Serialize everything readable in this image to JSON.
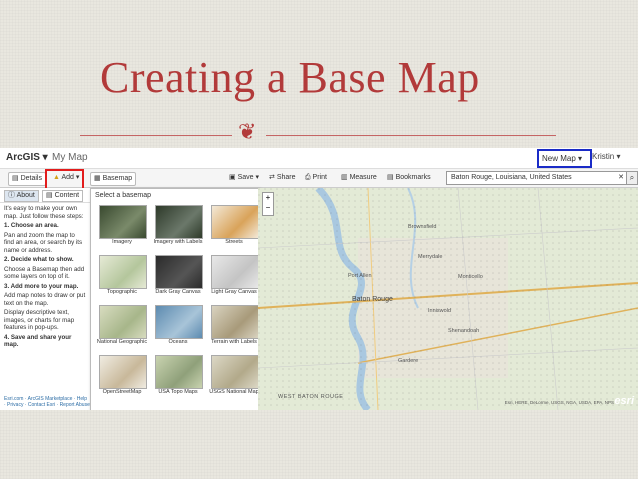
{
  "slide": {
    "title": "Creating a Base Map",
    "flourish": "❦"
  },
  "app": {
    "brand": "ArcGIS ▾",
    "map_title": "My Map",
    "new_map": "New Map ▾",
    "user": "Kristin ▾"
  },
  "toolbar": {
    "details": "Details",
    "add": "Add ▾",
    "basemap": "Basemap",
    "save": "Save ▾",
    "share": "Share",
    "print": "Print",
    "measure": "Measure",
    "bookmarks": "Bookmarks",
    "search_value": "Baton Rouge, Louisiana, United States",
    "search_clear": "✕"
  },
  "sidebar": {
    "tab_about": "About",
    "tab_content": "Content",
    "lines": [
      "It's easy to make your own map. Just follow these steps:",
      "1. Choose an area.",
      "Pan and zoom the map to find an area, or search by its name or address.",
      "2. Decide what to show.",
      "Choose a Basemap then add some layers on top of it.",
      "3. Add more to your map.",
      "Add map notes to draw or put text on the map.",
      "Display descriptive text, images, or charts for map features in pop-ups.",
      "4. Save and share your map."
    ],
    "footer": "Esri.com · ArcGIS Marketplace · Help · Privacy · Contact Esri · Report Abuse"
  },
  "basemap_panel": {
    "title": "Select a basemap",
    "options": [
      {
        "label": "Imagery",
        "c1": "#3a4a30",
        "c2": "#7a8a6a"
      },
      {
        "label": "Imagery with Labels",
        "c1": "#2e3a2a",
        "c2": "#6b786a"
      },
      {
        "label": "Streets",
        "c1": "#f3e9d8",
        "c2": "#d9a35a"
      },
      {
        "label": "Topographic",
        "c1": "#e6ead6",
        "c2": "#b4c69c"
      },
      {
        "label": "Dark Gray Canvas",
        "c1": "#2b2b2b",
        "c2": "#555555"
      },
      {
        "label": "Light Gray Canvas",
        "c1": "#e8e8e8",
        "c2": "#c4c4c4"
      },
      {
        "label": "National Geographic",
        "c1": "#d8dcc0",
        "c2": "#a7b68a"
      },
      {
        "label": "Oceans",
        "c1": "#5d8bb0",
        "c2": "#a8c4d8"
      },
      {
        "label": "Terrain with Labels",
        "c1": "#d9d3c0",
        "c2": "#a89a7a"
      },
      {
        "label": "OpenStreetMap",
        "c1": "#f0ece2",
        "c2": "#c8b89a"
      },
      {
        "label": "USA Topo Maps",
        "c1": "#c9d3b0",
        "c2": "#8fa07a"
      },
      {
        "label": "USGS National Map",
        "c1": "#dcd8c6",
        "c2": "#b2a98a"
      }
    ]
  },
  "map": {
    "labels": [
      "Baton Rouge",
      "Brownsfield",
      "Merrydale",
      "Monticello",
      "Shenandoah",
      "Gardere",
      "Port Allen",
      "Inniswold",
      "WEST BATON ROUGE"
    ],
    "attribution": "Esri, HERE, DeLorme, USGS, NGA, USDA, EPA, NPS",
    "logo": "esri",
    "zoom_in": "+",
    "zoom_out": "−"
  },
  "colors": {
    "title": "#b23a3a",
    "highlight_add": "#e21c1c",
    "highlight_newmap": "#1a2bc7",
    "river": "#a9c8e0"
  }
}
